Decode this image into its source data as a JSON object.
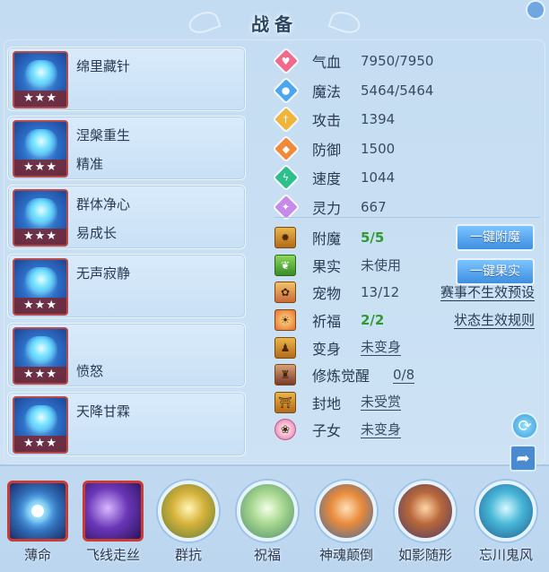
{
  "header": {
    "title": "战备"
  },
  "skills": [
    {
      "name": "绵里藏针",
      "sub": "",
      "stars": "★★★"
    },
    {
      "name": "涅槃重生",
      "sub": "精准",
      "stars": "★★★"
    },
    {
      "name": "群体净心",
      "sub": "易成长",
      "stars": "★★★"
    },
    {
      "name": "无声寂静",
      "sub": "",
      "stars": "★★★"
    },
    {
      "name": "",
      "sub": "愤怒",
      "stars": "★★★"
    },
    {
      "name": "天降甘霖",
      "sub": "",
      "stars": "★★★"
    }
  ],
  "stats": [
    {
      "label": "气血",
      "value": "7950/7950",
      "icon": "heart-icon",
      "color": "#f06a8a"
    },
    {
      "label": "魔法",
      "value": "5464/5464",
      "icon": "mana-icon",
      "color": "#4aa6f0"
    },
    {
      "label": "攻击",
      "value": "1394",
      "icon": "sword-icon",
      "color": "#f0b43a"
    },
    {
      "label": "防御",
      "value": "1500",
      "icon": "shield-icon",
      "color": "#f08a3a"
    },
    {
      "label": "速度",
      "value": "1044",
      "icon": "lightning-icon",
      "color": "#2ec08a"
    },
    {
      "label": "灵力",
      "value": "667",
      "icon": "spirit-icon",
      "color": "#c88ae8"
    }
  ],
  "extras": {
    "enchant": {
      "label": "附魔",
      "value": "5/5",
      "button": "一键附魔"
    },
    "fruit": {
      "label": "果实",
      "value": "未使用",
      "button": "一键果实"
    },
    "pet": {
      "label": "宠物",
      "value": "13/12",
      "link": "赛事不生效预设"
    },
    "bless": {
      "label": "祈福",
      "value": "2/2",
      "link": "状态生效规则"
    },
    "transform": {
      "label": "变身",
      "value": "未变身"
    },
    "cultivate": {
      "label": "修炼觉醒",
      "value": "0/8"
    },
    "fief": {
      "label": "封地",
      "value": "未受赏"
    },
    "fairy": {
      "label": "子女",
      "value": "未变身"
    }
  },
  "bottom_skills": [
    {
      "label": "薄命"
    },
    {
      "label": "飞线走丝"
    },
    {
      "label": "群抗"
    },
    {
      "label": "祝福"
    },
    {
      "label": "神魂颠倒"
    },
    {
      "label": "如影随形"
    },
    {
      "label": "忘川鬼风"
    }
  ]
}
